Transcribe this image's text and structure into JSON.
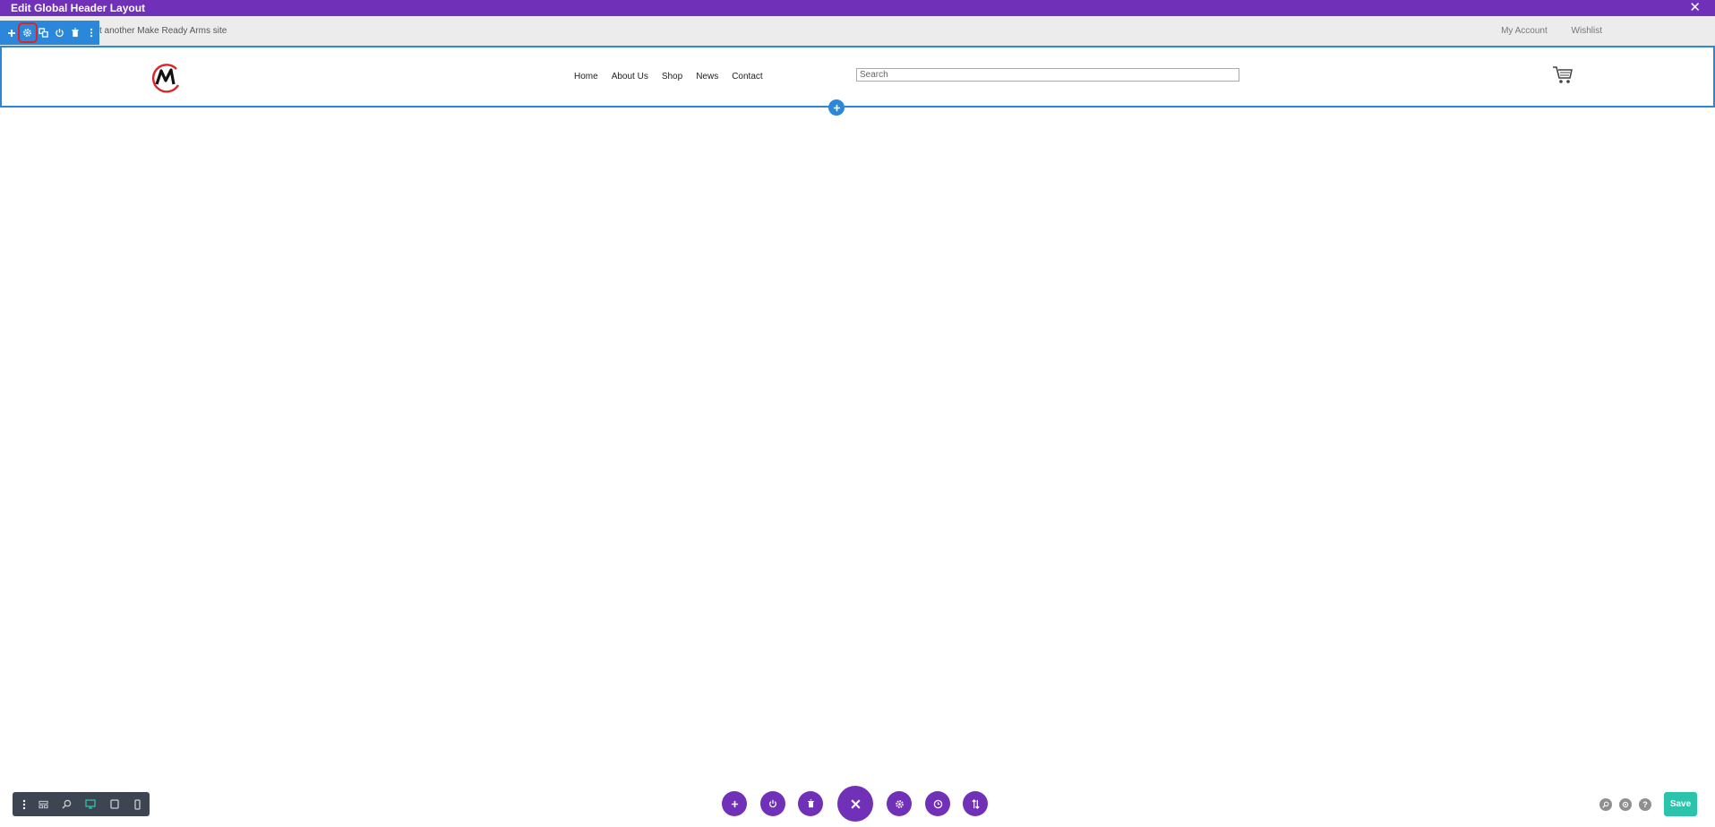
{
  "window": {
    "title": "Edit Global Header Layout"
  },
  "topbar": {
    "tagline": "st another Make Ready Arms site",
    "links": [
      "My Account",
      "Wishlist"
    ]
  },
  "section_toolbar": {
    "icons": [
      "plus-icon",
      "gear-icon",
      "duplicate-icon",
      "power-icon",
      "trash-icon",
      "more-dots-icon"
    ],
    "active": "gear-icon"
  },
  "header": {
    "nav": [
      "Home",
      "About Us",
      "Shop",
      "News",
      "Contact"
    ],
    "search_placeholder": "Search"
  },
  "bottom_left_bar": {
    "icons": [
      "more-dots-icon",
      "wireframe-icon",
      "zoom-icon",
      "desktop-icon",
      "tablet-icon",
      "phone-icon"
    ],
    "active": "desktop-icon"
  },
  "bottom_controls": [
    "add-icon",
    "power-icon",
    "trash-icon",
    "close-icon",
    "gear-icon",
    "history-icon",
    "sort-icon"
  ],
  "bottom_right": {
    "help": "?",
    "save_label": "Save"
  },
  "colors": {
    "purple": "#7030b8",
    "blue": "#2b87da",
    "green": "#29c4a9",
    "logo_red": "#d9242a"
  }
}
